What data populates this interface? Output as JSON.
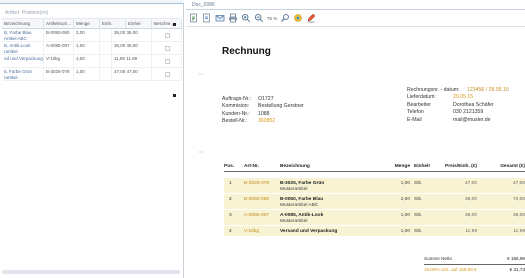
{
  "left": {
    "header_text": "Artikel: Position(en)",
    "columns": [
      "Bezeichnung",
      "Artikelnum...",
      "Menge",
      "Einh.",
      "Einhei",
      "Beschre..."
    ],
    "rows": [
      {
        "bez": "B, Farbe Blau Artikel ABC",
        "art": "B-0050-050",
        "menge": "2,00",
        "einh": "",
        "preis": "36,00",
        "ges": "36,00"
      },
      {
        "bez": "B, Antik-Look rartikel",
        "art": "A-0085-007",
        "menge": "1,00",
        "einh": "",
        "preis": "36,00",
        "ges": "36,00"
      },
      {
        "bez": "nd und Verpackung",
        "art": "V-10kg",
        "menge": "1,00",
        "einh": "",
        "preis": "11,99",
        "ges": "11,99"
      },
      {
        "bez": "5, Farbe Grün rartikel",
        "art": "B-3025-078",
        "menge": "1,00",
        "einh": "",
        "preis": "47,00",
        "ges": "47,00"
      }
    ]
  },
  "doc": {
    "window_title": "Doc_0086",
    "zoom": "75 %",
    "title": "Rechnung",
    "meta_left": [
      {
        "label": "Auftrags-Nr.:",
        "value": "O1727",
        "orange": false
      },
      {
        "label": "Kommision:",
        "value": "Bestellung Gerstner",
        "orange": false
      },
      {
        "label": "Kunden-Nr.:",
        "value": "1088",
        "orange": false
      },
      {
        "label": "Bestell-Nr.:",
        "value": "360852",
        "orange": true
      }
    ],
    "meta_right": [
      {
        "label": "Rechnungsnr. - datum:",
        "value": "123456 / 29.05.15"
      },
      {
        "label": "Lieferdatum:",
        "value": "29.05.15"
      },
      {
        "label": "Bearbeiter",
        "value": "Dorothea Schäfer"
      },
      {
        "label": "Telefon",
        "value": "030 2121359"
      },
      {
        "label": "E-Mail",
        "value": "mail@muster.de"
      }
    ],
    "table_head": {
      "pos": "Pos.",
      "art": "Art-Nr.",
      "bez": "Bezeichnung",
      "menge": "Menge",
      "einh": "Einheit",
      "preis": "Preis/Einh. (€)",
      "ges": "Gesamt (€)"
    },
    "items": [
      {
        "pos": "1",
        "art": "B-3025-078",
        "bez": "B-3025, Farbe Grün",
        "sub": "Musterartikel",
        "menge": "1,00",
        "einh": "Stk.",
        "preis": "47,00",
        "ges": "47,00"
      },
      {
        "pos": "2",
        "art": "B-0050-050",
        "bez": "B-0050, Farbe Blau",
        "sub": "Musterartikel ABC",
        "menge": "2,00",
        "einh": "Stk.",
        "preis": "36,00",
        "ges": "72,00"
      },
      {
        "pos": "3",
        "art": "A-0085-007",
        "bez": "A-0085, Antik-Look",
        "sub": "Musterartikel",
        "menge": "1,00",
        "einh": "Stk.",
        "preis": "36,00",
        "ges": "36,00"
      },
      {
        "pos": "4",
        "art": "V-10kg",
        "bez": "Versand und Verpackung",
        "sub": "",
        "menge": "1,00",
        "einh": "Stk.",
        "preis": "11,99",
        "ges": "11,99"
      }
    ],
    "totals": {
      "netto_label": "Summe Netto",
      "netto_value": "€ 166,99",
      "vat_label": "19,00% USt. auf 166,99 €",
      "vat_value": "€ 31,73"
    }
  },
  "colors": {
    "accent_orange": "#d79a1a",
    "row_highlight": "#f8f3d2"
  }
}
